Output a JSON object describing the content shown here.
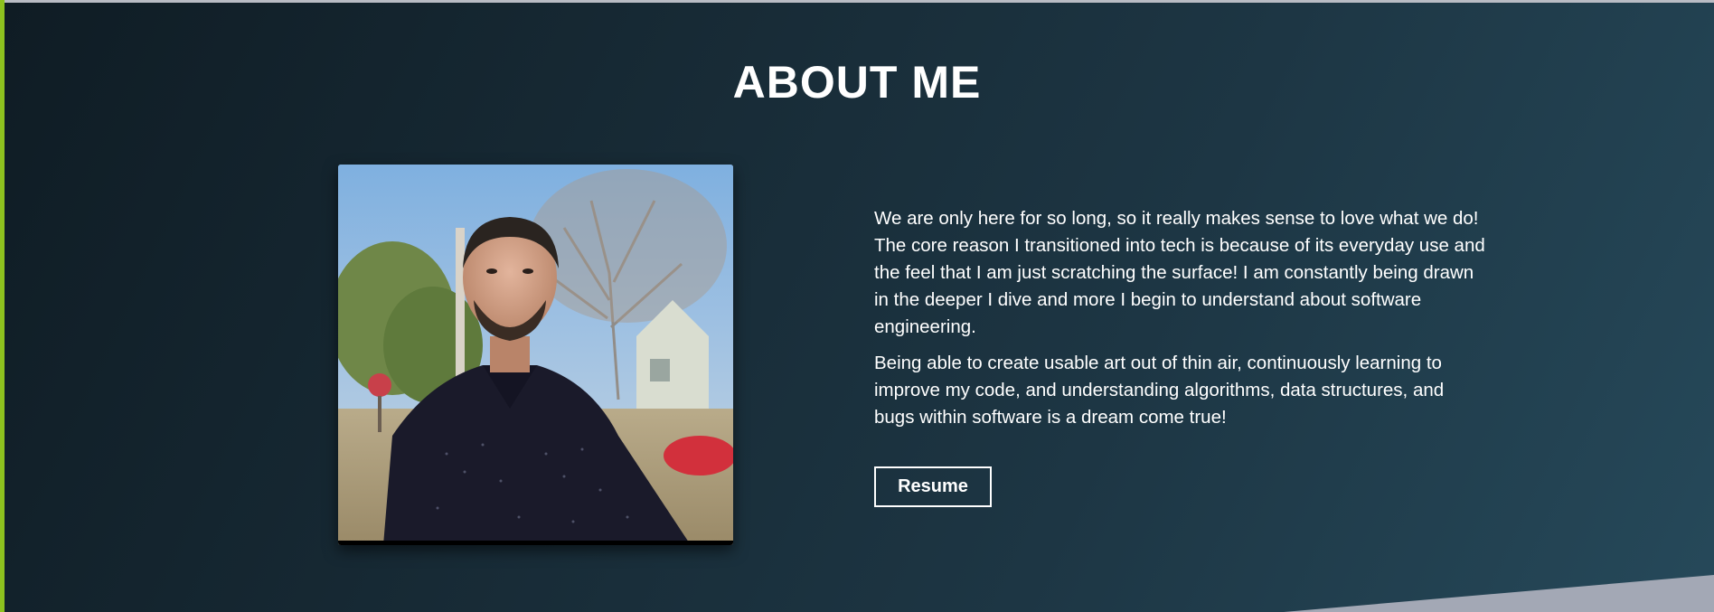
{
  "section": {
    "title": "ABOUT ME"
  },
  "bio": {
    "paragraphs": [
      "We are only here for so long, so it really makes sense to love what we do! The core reason I transitioned into tech is because of its everyday use and the feel that I am just scratching the surface! I am constantly being drawn in the deeper I dive and more I begin to understand about software engineering.",
      "Being able to create usable art out of thin air, continuously learning to improve my code, and understanding algorithms, data structures, and bugs within software is a dream come true!"
    ]
  },
  "resume_button": {
    "label": "Resume"
  },
  "colors": {
    "accent": "#8dc21f",
    "background_dark": "#0f1c24",
    "background_light": "#26495a",
    "text": "#ffffff",
    "wedge": "#a3a8b5"
  }
}
